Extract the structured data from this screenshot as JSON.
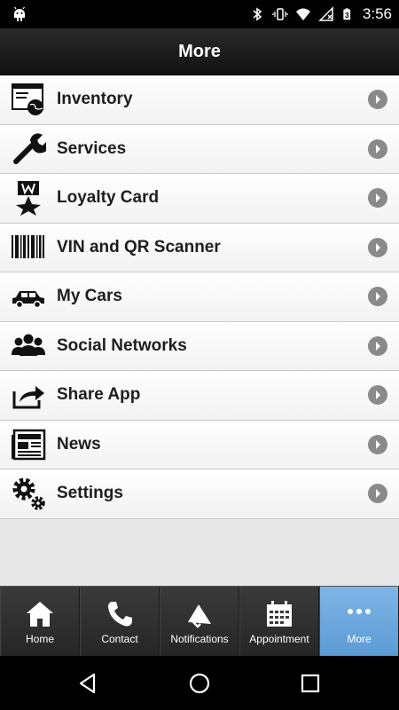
{
  "status_bar": {
    "time": "3:56",
    "icons": [
      "android-debug-icon",
      "bluetooth-icon",
      "vibrate-icon",
      "wifi-icon",
      "no-sim-icon",
      "battery-icon"
    ],
    "battery_level": "3"
  },
  "header": {
    "title": "More"
  },
  "menu": {
    "items": [
      {
        "label": "Inventory",
        "icon": "inventory-globe-icon"
      },
      {
        "label": "Services",
        "icon": "wrench-icon"
      },
      {
        "label": "Loyalty Card",
        "icon": "loyalty-badge-icon"
      },
      {
        "label": "VIN and QR Scanner",
        "icon": "barcode-icon"
      },
      {
        "label": "My Cars",
        "icon": "car-icon"
      },
      {
        "label": "Social Networks",
        "icon": "people-icon"
      },
      {
        "label": "Share App",
        "icon": "share-icon"
      },
      {
        "label": "News",
        "icon": "newspaper-icon"
      },
      {
        "label": "Settings",
        "icon": "gears-icon"
      }
    ]
  },
  "tab_bar": {
    "tabs": [
      {
        "label": "Home",
        "icon": "home-icon",
        "active": false
      },
      {
        "label": "Contact",
        "icon": "phone-icon",
        "active": false
      },
      {
        "label": "Notifications",
        "icon": "megaphone-icon",
        "active": false
      },
      {
        "label": "Appointment",
        "icon": "calendar-icon",
        "active": false
      },
      {
        "label": "More",
        "icon": "more-dots-icon",
        "active": true
      }
    ],
    "active_color": "#6aa8df"
  },
  "nav_bar": {
    "buttons": [
      "back-icon",
      "home-circle-icon",
      "recents-icon"
    ]
  }
}
